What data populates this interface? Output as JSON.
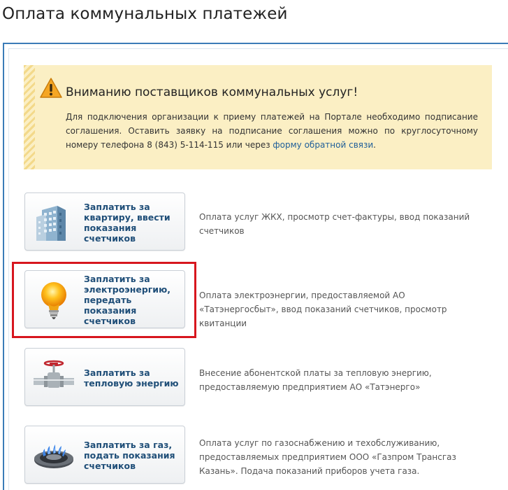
{
  "page": {
    "title": "Оплата коммунальных платежей"
  },
  "notice": {
    "title": "Вниманию поставщиков коммунальных услуг!",
    "text_before": "Для подключения организации к приему платежей на Портале необходимо подписание соглашения. Оставить заявку на подписание соглашения можно по круглосуточному номеру телефона 8 (843) 5-114-115 или через ",
    "link": "форму обратной связи",
    "text_after": "."
  },
  "services": [
    {
      "label": "Заплатить за квартиру, ввести показания счетчиков",
      "description": "Оплата услуг ЖКХ, просмотр счет-фактуры, ввод показаний счетчиков",
      "icon": "apartment-building-icon"
    },
    {
      "label": "Заплатить за электроэнергию, передать показания счетчиков",
      "description": "Оплата электроэнергии, предоставляемой АО «Татэнергосбыт», ввод показаний счетчиков, просмотр квитанции",
      "icon": "light-bulb-icon"
    },
    {
      "label": "Заплатить за тепловую энергию",
      "description": "Внесение абонентской платы за тепловую энергию, предоставляемую предприятием АО «Татэнерго»",
      "icon": "valve-pipe-icon"
    },
    {
      "label": "Заплатить за газ, подать показания счетчиков",
      "description": "Оплата услуг по газоснабжению и техобслуживанию, предоставляемых предприятием ООО «Газпром Трансгаз Казань». Подача показаний приборов учета газа.",
      "icon": "gas-burner-icon"
    }
  ],
  "colors": {
    "frame_border": "#3b7cb8",
    "notice_bg": "#fbefc4",
    "highlight_border": "#d7161e",
    "link": "#1f5e99",
    "button_text": "#1f4e78"
  }
}
